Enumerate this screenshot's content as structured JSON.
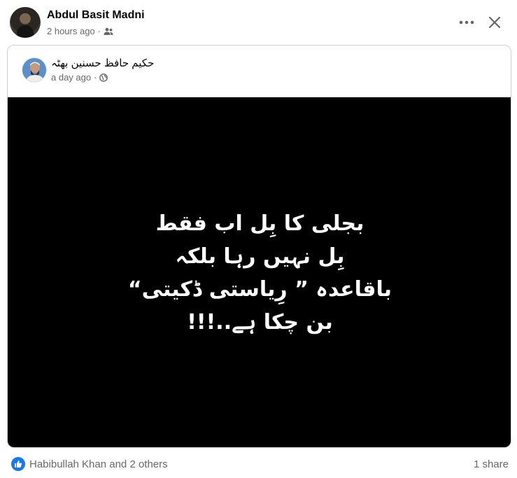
{
  "post": {
    "author": "Abdul Basit Madni",
    "timestamp": "2 hours ago",
    "separator": "·",
    "audience_icon": "friends-icon",
    "more_icon": "more-horizontal-icon",
    "close_icon": "close-icon"
  },
  "shared": {
    "author": "حکیم حافظ حسنین بھٹہ",
    "timestamp": "a day ago",
    "separator": "·",
    "audience_icon": "globe-icon",
    "image_lines": [
      "بجلی کا بِل اب فقط",
      "بِل نہیں رہا بلکہ",
      "باقاعدہ ” رِیاستی ڈکیتی“",
      "بن چکا ہے..!!!"
    ]
  },
  "footer": {
    "reactions": "Habibullah Khan and 2 others",
    "shares": "1 share",
    "like_color": "#1877f2"
  }
}
